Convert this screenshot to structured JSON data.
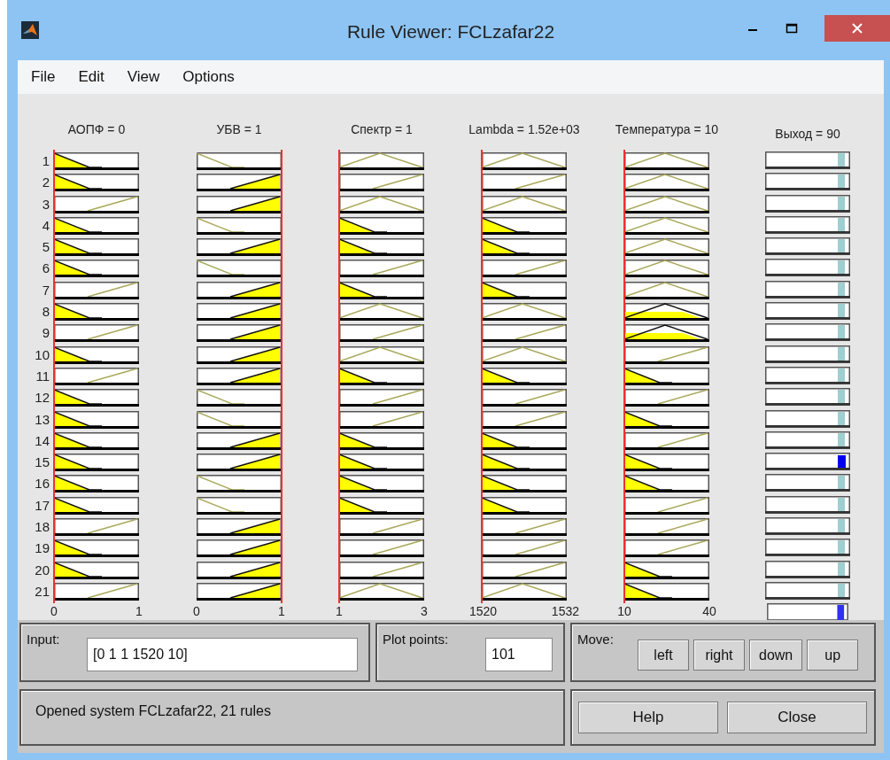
{
  "window": {
    "title": "Rule Viewer: FCLzafar22"
  },
  "menu": [
    "File",
    "Edit",
    "View",
    "Options"
  ],
  "rule_numbers": [
    "1",
    "2",
    "3",
    "4",
    "5",
    "6",
    "7",
    "8",
    "9",
    "10",
    "11",
    "12",
    "13",
    "14",
    "15",
    "16",
    "17",
    "18",
    "19",
    "20",
    "21"
  ],
  "variables": [
    {
      "header": "АОПФ = 0",
      "at_max": false,
      "tick_min": "0",
      "tick_max": "1",
      "plots": [
        {
          "kind": "low",
          "fired": true
        },
        {
          "kind": "low",
          "fired": true
        },
        {
          "kind": "high",
          "fired": false
        },
        {
          "kind": "low",
          "fired": true
        },
        {
          "kind": "low",
          "fired": true
        },
        {
          "kind": "low",
          "fired": true
        },
        {
          "kind": "high",
          "fired": false
        },
        {
          "kind": "low",
          "fired": true
        },
        {
          "kind": "high",
          "fired": false
        },
        {
          "kind": "low",
          "fired": true
        },
        {
          "kind": "high",
          "fired": false
        },
        {
          "kind": "low",
          "fired": true
        },
        {
          "kind": "low",
          "fired": true
        },
        {
          "kind": "low",
          "fired": true
        },
        {
          "kind": "low",
          "fired": true
        },
        {
          "kind": "low",
          "fired": true
        },
        {
          "kind": "low",
          "fired": true
        },
        {
          "kind": "high",
          "fired": false
        },
        {
          "kind": "low",
          "fired": true
        },
        {
          "kind": "low",
          "fired": true
        },
        {
          "kind": "high",
          "fired": false
        }
      ]
    },
    {
      "header": "УБВ = 1",
      "at_max": true,
      "tick_min": "0",
      "tick_max": "1",
      "plots": [
        {
          "kind": "low",
          "fired": false
        },
        {
          "kind": "high",
          "fired": true
        },
        {
          "kind": "high",
          "fired": true
        },
        {
          "kind": "low",
          "fired": false
        },
        {
          "kind": "high",
          "fired": true
        },
        {
          "kind": "low",
          "fired": false
        },
        {
          "kind": "high",
          "fired": true
        },
        {
          "kind": "high",
          "fired": true
        },
        {
          "kind": "high",
          "fired": true
        },
        {
          "kind": "high",
          "fired": true
        },
        {
          "kind": "high",
          "fired": true
        },
        {
          "kind": "low",
          "fired": false
        },
        {
          "kind": "low",
          "fired": false
        },
        {
          "kind": "high",
          "fired": true
        },
        {
          "kind": "high",
          "fired": true
        },
        {
          "kind": "low",
          "fired": false
        },
        {
          "kind": "low",
          "fired": false
        },
        {
          "kind": "high",
          "fired": true
        },
        {
          "kind": "high",
          "fired": true
        },
        {
          "kind": "high",
          "fired": true
        },
        {
          "kind": "high",
          "fired": true
        }
      ]
    },
    {
      "header": "Спектр = 1",
      "at_max": false,
      "tick_min": "1",
      "tick_max": "3",
      "plots": [
        {
          "kind": "mid",
          "fired": false
        },
        {
          "kind": "high",
          "fired": false
        },
        {
          "kind": "mid",
          "fired": false
        },
        {
          "kind": "low",
          "fired": true
        },
        {
          "kind": "low",
          "fired": true
        },
        {
          "kind": "high",
          "fired": false
        },
        {
          "kind": "low",
          "fired": true
        },
        {
          "kind": "mid",
          "fired": false
        },
        {
          "kind": "high",
          "fired": false
        },
        {
          "kind": "mid",
          "fired": false
        },
        {
          "kind": "low",
          "fired": true
        },
        {
          "kind": "high",
          "fired": false
        },
        {
          "kind": "high",
          "fired": false
        },
        {
          "kind": "low",
          "fired": true
        },
        {
          "kind": "low",
          "fired": true
        },
        {
          "kind": "low",
          "fired": true
        },
        {
          "kind": "low",
          "fired": true
        },
        {
          "kind": "high",
          "fired": false
        },
        {
          "kind": "high",
          "fired": false
        },
        {
          "kind": "high",
          "fired": false
        },
        {
          "kind": "mid",
          "fired": false
        }
      ]
    },
    {
      "header": "Lambda = 1.52e+03",
      "at_max": false,
      "tick_min": "1520",
      "tick_max": "1532",
      "plots": [
        {
          "kind": "mid",
          "fired": false
        },
        {
          "kind": "high",
          "fired": false
        },
        {
          "kind": "mid",
          "fired": false
        },
        {
          "kind": "low",
          "fired": true
        },
        {
          "kind": "low",
          "fired": true
        },
        {
          "kind": "high",
          "fired": false
        },
        {
          "kind": "low",
          "fired": true
        },
        {
          "kind": "mid",
          "fired": false
        },
        {
          "kind": "high",
          "fired": false
        },
        {
          "kind": "mid",
          "fired": false
        },
        {
          "kind": "low",
          "fired": true
        },
        {
          "kind": "high",
          "fired": false
        },
        {
          "kind": "high",
          "fired": false
        },
        {
          "kind": "low",
          "fired": true
        },
        {
          "kind": "low",
          "fired": true
        },
        {
          "kind": "low",
          "fired": true
        },
        {
          "kind": "low",
          "fired": true
        },
        {
          "kind": "high",
          "fired": false
        },
        {
          "kind": "high",
          "fired": false
        },
        {
          "kind": "high",
          "fired": false
        },
        {
          "kind": "mid",
          "fired": false
        }
      ]
    },
    {
      "header": "Температура = 10",
      "at_max": false,
      "tick_min": "10",
      "tick_max": "40",
      "plots": [
        {
          "kind": "mid",
          "fired": false
        },
        {
          "kind": "mid",
          "fired": false
        },
        {
          "kind": "mid",
          "fired": false
        },
        {
          "kind": "mid",
          "fired": false
        },
        {
          "kind": "mid",
          "fired": false
        },
        {
          "kind": "mid",
          "fired": false
        },
        {
          "kind": "mid",
          "fired": false
        },
        {
          "kind": "mid",
          "fired": true
        },
        {
          "kind": "mid",
          "fired": true
        },
        {
          "kind": "high",
          "fired": false
        },
        {
          "kind": "low",
          "fired": true
        },
        {
          "kind": "high",
          "fired": false
        },
        {
          "kind": "low",
          "fired": true
        },
        {
          "kind": "high",
          "fired": false
        },
        {
          "kind": "low",
          "fired": true
        },
        {
          "kind": "low",
          "fired": true
        },
        {
          "kind": "high",
          "fired": false
        },
        {
          "kind": "high",
          "fired": false
        },
        {
          "kind": "high",
          "fired": false
        },
        {
          "kind": "low",
          "fired": true
        },
        {
          "kind": "low",
          "fired": true
        }
      ]
    }
  ],
  "output": {
    "header": "Выход = 90",
    "plots": [
      {
        "active": false
      },
      {
        "active": false
      },
      {
        "active": false
      },
      {
        "active": false
      },
      {
        "active": false
      },
      {
        "active": false
      },
      {
        "active": false
      },
      {
        "active": false
      },
      {
        "active": false
      },
      {
        "active": false
      },
      {
        "active": false
      },
      {
        "active": false
      },
      {
        "active": false
      },
      {
        "active": false
      },
      {
        "active": true
      },
      {
        "active": false
      },
      {
        "active": false
      },
      {
        "active": false
      },
      {
        "active": false
      },
      {
        "active": false
      },
      {
        "active": false
      }
    ]
  },
  "input": {
    "label": "Input:",
    "value": "[0 1 1 1520 10]"
  },
  "plot_points": {
    "label": "Plot points:",
    "value": "101"
  },
  "move": {
    "label": "Move:",
    "buttons": [
      "left",
      "right",
      "down",
      "up"
    ]
  },
  "status": "Opened system FCLzafar22, 21 rules",
  "buttons": [
    "Help",
    "Close"
  ]
}
